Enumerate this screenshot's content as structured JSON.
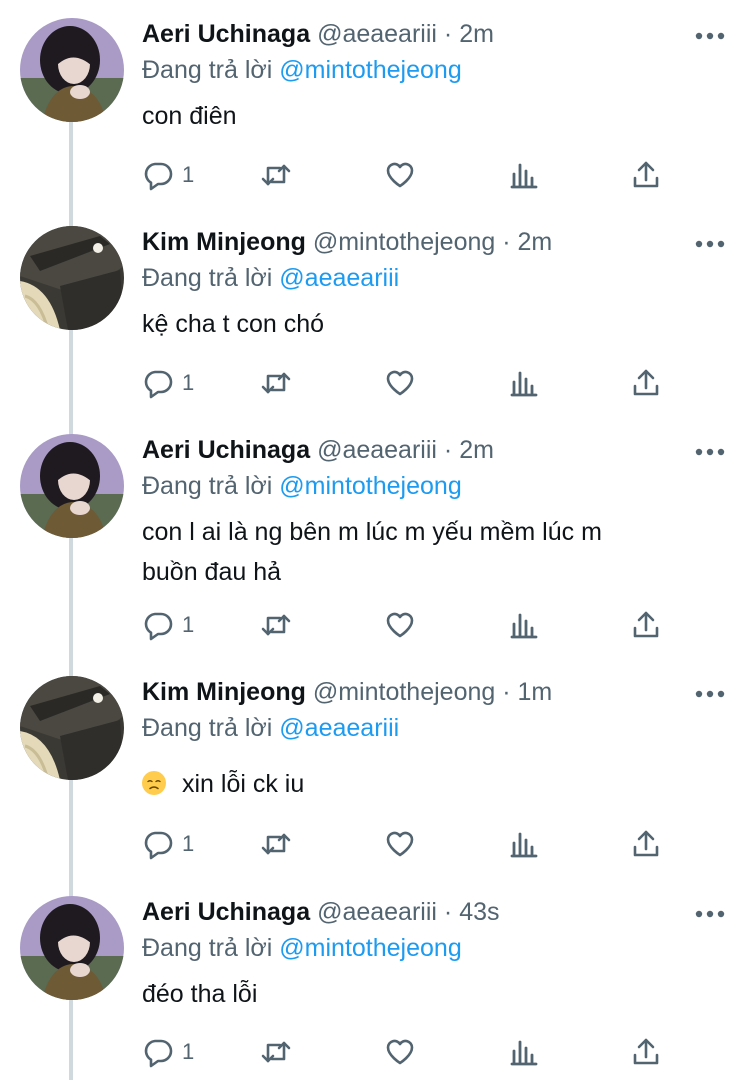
{
  "labels": {
    "replying_to": "Đang trả lời"
  },
  "tweets": [
    {
      "name": "Aeri Uchinaga",
      "handle": "@aeaeariii",
      "time": "2m",
      "mention": "@mintothejeong",
      "text": "con điên",
      "text2": "",
      "emoji": "",
      "reply_count": "1"
    },
    {
      "name": "Kim Minjeong",
      "handle": "@mintothejeong",
      "time": "2m",
      "mention": "@aeaeariii",
      "text": "kệ cha t con chó",
      "text2": "",
      "emoji": "",
      "reply_count": "1"
    },
    {
      "name": "Aeri Uchinaga",
      "handle": "@aeaeariii",
      "time": "2m",
      "mention": "@mintothejeong",
      "text": "con l ai là ng bên m lúc m yếu mềm lúc m",
      "text2": "buồn đau hả",
      "emoji": "",
      "reply_count": "1"
    },
    {
      "name": "Kim Minjeong",
      "handle": "@mintothejeong",
      "time": "1m",
      "mention": "@aeaeariii",
      "text": "xin lỗi ck iu",
      "text2": "",
      "emoji": "disappointed-face",
      "reply_count": "1"
    },
    {
      "name": "Aeri Uchinaga",
      "handle": "@aeaeariii",
      "time": "43s",
      "mention": "@mintothejeong",
      "text": "đéo tha lỗi",
      "text2": "",
      "emoji": "",
      "reply_count": "1"
    }
  ],
  "icons": {
    "avatar_aeri": "avatar-aeri",
    "avatar_minjeong": "avatar-minjeong",
    "more": "more-horizontal-icon",
    "reply": "reply-icon",
    "retweet": "retweet-icon",
    "like": "heart-icon",
    "views": "analytics-icon",
    "share": "share-icon"
  },
  "colors": {
    "accent": "#1d9bf0",
    "secondary_text": "#536471",
    "primary_text": "#0f1419",
    "thread_line": "#cfd9de"
  }
}
